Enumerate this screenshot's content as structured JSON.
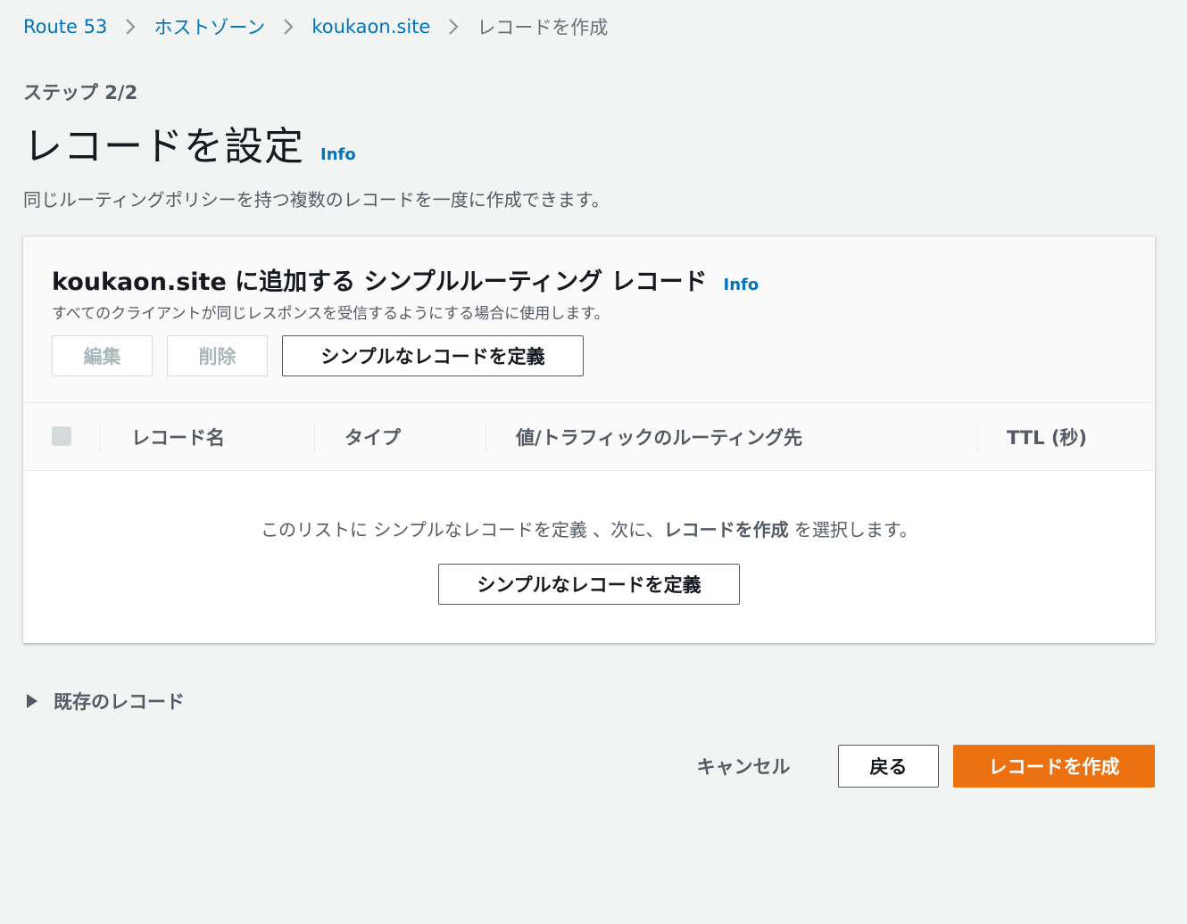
{
  "breadcrumb": {
    "items": [
      "Route 53",
      "ホストゾーン",
      "koukaon.site"
    ],
    "current": "レコードを作成"
  },
  "header": {
    "step": "ステップ 2/2",
    "title": "レコードを設定",
    "info": "Info",
    "description": "同じルーティングポリシーを持つ複数のレコードを一度に作成できます。"
  },
  "records_panel": {
    "title": "koukaon.site に追加する シンプルルーティング レコード",
    "info": "Info",
    "description": "すべてのクライアントが同じレスポンスを受信するようにする場合に使用します。",
    "actions": {
      "edit": "編集",
      "delete": "削除",
      "define": "シンプルなレコードを定義"
    },
    "columns": [
      "レコード名",
      "タイプ",
      "値/トラフィックのルーティング先",
      "TTL (秒)"
    ],
    "empty": {
      "prefix": "このリストに シンプルなレコードを定義 、次に、",
      "bold": "レコードを作成",
      "suffix": " を選択します。",
      "button": "シンプルなレコードを定義"
    }
  },
  "existing_records": {
    "label": "既存のレコード",
    "expanded": false
  },
  "footer": {
    "cancel": "キャンセル",
    "back": "戻る",
    "create": "レコードを作成"
  },
  "colors": {
    "link": "#0073bb",
    "primary": "#ec7211",
    "background": "#f2f3f3"
  }
}
